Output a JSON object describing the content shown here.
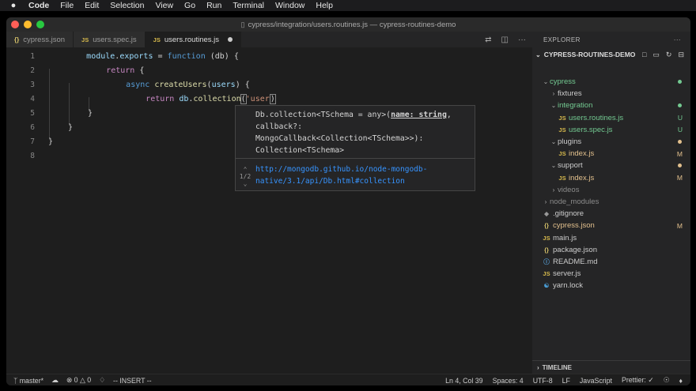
{
  "menubar": {
    "apple": "",
    "app": "Code",
    "items": [
      "File",
      "Edit",
      "Selection",
      "View",
      "Go",
      "Run",
      "Terminal",
      "Window",
      "Help"
    ]
  },
  "window": {
    "title": "cypress/integration/users.routines.js — cypress-routines-demo"
  },
  "tabs": [
    {
      "label": "cypress.json",
      "icon": "{}",
      "active": false
    },
    {
      "label": "users.spec.js",
      "icon": "JS",
      "active": false
    },
    {
      "label": "users.routines.js",
      "icon": "JS",
      "active": true,
      "modified": true
    }
  ],
  "editor": {
    "line_numbers": [
      "1",
      "2",
      "3",
      "4",
      "5",
      "6",
      "7",
      "8"
    ],
    "lines": {
      "l1": {
        "a": "module",
        "b": ".",
        "c": "exports",
        "d": " = ",
        "e": "function",
        "f": " (db) {"
      },
      "l2": {
        "a": "return",
        "b": " {"
      },
      "l3": {
        "a": "async",
        "b": " ",
        "c": "createUsers",
        "d": "(",
        "e": "users",
        "f": ") {"
      },
      "l4": {
        "a": "return",
        "b": " ",
        "c": "db",
        "d": ".",
        "e": "collection",
        "f": "(",
        "g": "'user",
        "h": ")"
      },
      "l5": {
        "a": "}"
      },
      "l6": {
        "a": "}"
      },
      "l7": {
        "a": "}"
      }
    }
  },
  "hover": {
    "sig_pre": "Db.collection<TSchema = any>(",
    "sig_param": "name: string",
    "sig_post": ",\ncallback?:\nMongoCallback<Collection<TSchema>>):\nCollection<TSchema>",
    "page": "1/2",
    "doc_link": "http://mongodb.github.io/node-mongodb-native/3.1/api/Db.html#collection"
  },
  "explorer": {
    "header": "EXPLORER",
    "root": "CYPRESS-ROUTINES-DEMO",
    "items": [
      {
        "label": "cypress",
        "kind": "folder-open",
        "indent": 0,
        "color": "green",
        "status": "dot"
      },
      {
        "label": "fixtures",
        "kind": "folder",
        "indent": 1,
        "color": "normal"
      },
      {
        "label": "integration",
        "kind": "folder-open",
        "indent": 1,
        "color": "green",
        "status": "dot"
      },
      {
        "label": "users.routines.js",
        "kind": "js",
        "indent": 2,
        "color": "green",
        "status": "U"
      },
      {
        "label": "users.spec.js",
        "kind": "js",
        "indent": 2,
        "color": "green",
        "status": "U"
      },
      {
        "label": "plugins",
        "kind": "folder-open",
        "indent": 1,
        "color": "normal",
        "status": "mdot"
      },
      {
        "label": "index.js",
        "kind": "js",
        "indent": 2,
        "color": "mod",
        "status": "M"
      },
      {
        "label": "support",
        "kind": "folder-open",
        "indent": 1,
        "color": "normal",
        "status": "mdot"
      },
      {
        "label": "index.js",
        "kind": "js",
        "indent": 2,
        "color": "mod",
        "status": "M"
      },
      {
        "label": "videos",
        "kind": "folder",
        "indent": 1,
        "color": "dim"
      },
      {
        "label": "node_modules",
        "kind": "folder",
        "indent": 0,
        "color": "dim"
      },
      {
        "label": ".gitignore",
        "kind": "git",
        "indent": 0,
        "color": "normal"
      },
      {
        "label": "cypress.json",
        "kind": "json",
        "indent": 0,
        "color": "mod",
        "status": "M"
      },
      {
        "label": "main.js",
        "kind": "js",
        "indent": 0,
        "color": "normal"
      },
      {
        "label": "package.json",
        "kind": "json",
        "indent": 0,
        "color": "normal"
      },
      {
        "label": "README.md",
        "kind": "info",
        "indent": 0,
        "color": "normal"
      },
      {
        "label": "server.js",
        "kind": "js",
        "indent": 0,
        "color": "normal"
      },
      {
        "label": "yarn.lock",
        "kind": "yarn",
        "indent": 0,
        "color": "normal"
      }
    ],
    "timeline": "TIMELINE"
  },
  "statusbar": {
    "branch": "master*",
    "sync_icon": "sync-icon",
    "errors": "0",
    "warnings": "0",
    "mode": "-- INSERT --",
    "position": "Ln 4, Col 39",
    "spaces": "Spaces: 4",
    "encoding": "UTF-8",
    "eol": "LF",
    "language": "JavaScript",
    "prettier": "Prettier: ✓"
  },
  "colors": {
    "keyword": "#569cd6",
    "control": "#c586c0",
    "variable": "#9cdcfe",
    "function": "#dcdcaa",
    "string": "#ce9178",
    "untracked": "#73c991",
    "modified": "#e2c08d",
    "link": "#3794ff"
  }
}
